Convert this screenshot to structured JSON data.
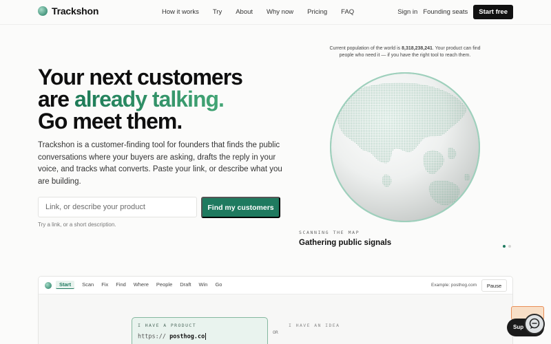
{
  "brand": {
    "name": "Trackshon",
    "accent": "#1f7a5f"
  },
  "nav": {
    "links": [
      "How it works",
      "Try",
      "About",
      "Why now",
      "Pricing",
      "FAQ"
    ],
    "sign_in": "Sign in",
    "founding_seats": "Founding seats",
    "start_free": "Start free"
  },
  "hero": {
    "line1": "Your next customers",
    "line2_pre": "are ",
    "line2_accent": "already talking.",
    "line3": "Go meet them.",
    "description": "Trackshon is a customer-finding tool for founders that finds the public conversations where your buyers are asking, drafts the reply in your voice, and tracks what converts. Paste your link, or describe what you are building.",
    "input_placeholder": "Link, or describe your product",
    "cta": "Find my customers",
    "hint": "Try a link, or a short description."
  },
  "population": {
    "prefix": "Current population of the world is ",
    "count": "8,318,238,241",
    "suffix": ". Your product can find people who need it — if you have the right tool to reach them."
  },
  "scan": {
    "label": "SCANNING THE MAP",
    "title": "Gathering public signals",
    "dots_total": 2,
    "dots_active": 1
  },
  "app": {
    "tabs": [
      "Start",
      "Scan",
      "Fix",
      "Find",
      "Where",
      "People",
      "Draft",
      "Win",
      "Go"
    ],
    "active_tab": "Start",
    "example": "Example: posthog.com",
    "pause": "Pause",
    "have_product_label": "I HAVE A PRODUCT",
    "url_prefix": "https://",
    "url_value": "posthog.co",
    "or": "OR",
    "have_idea_label": "I HAVE AN IDEA"
  },
  "support": {
    "label": "Sup"
  },
  "icons": {
    "logo": "globe-logo-icon",
    "globe": "earth-globe-icon",
    "support": "chat-support-icon"
  }
}
